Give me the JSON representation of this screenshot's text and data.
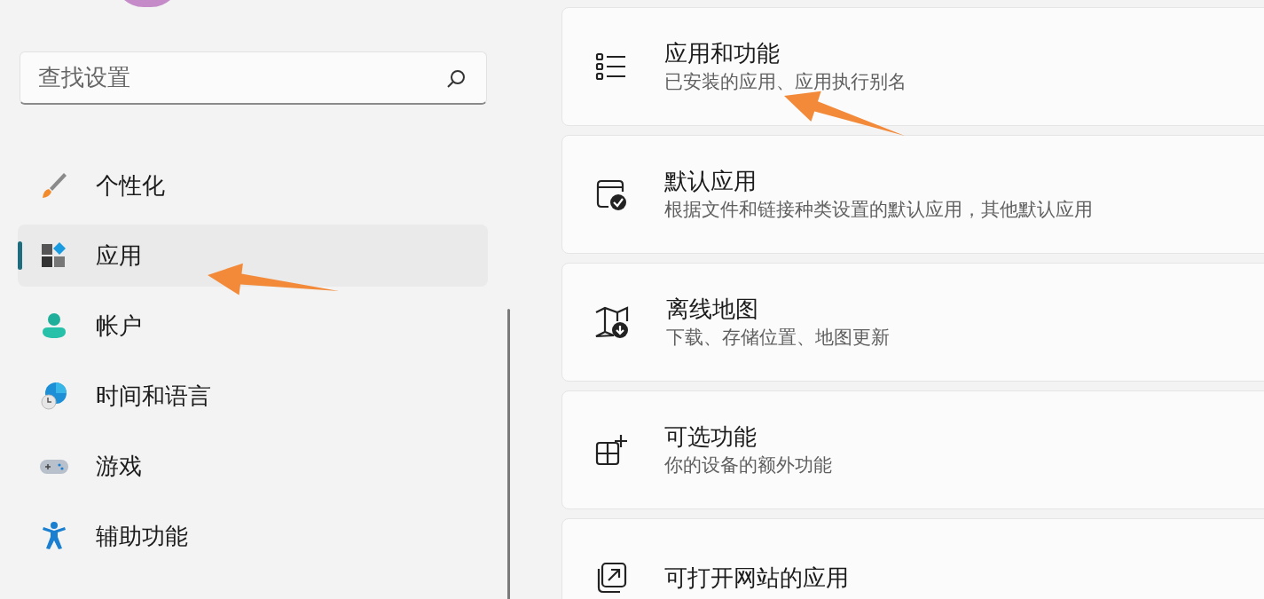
{
  "sidebar": {
    "search": {
      "placeholder": "查找设置"
    },
    "items": [
      {
        "label": "个性化",
        "selected": false
      },
      {
        "label": "应用",
        "selected": true
      },
      {
        "label": "帐户",
        "selected": false
      },
      {
        "label": "时间和语言",
        "selected": false
      },
      {
        "label": "游戏",
        "selected": false
      },
      {
        "label": "辅助功能",
        "selected": false
      }
    ]
  },
  "cards": [
    {
      "title": "应用和功能",
      "subtitle": "已安装的应用、应用执行别名"
    },
    {
      "title": "默认应用",
      "subtitle": "根据文件和链接种类设置的默认应用，其他默认应用"
    },
    {
      "title": "离线地图",
      "subtitle": "下载、存储位置、地图更新"
    },
    {
      "title": "可选功能",
      "subtitle": "你的设备的额外功能"
    },
    {
      "title": "可打开网站的应用"
    }
  ]
}
